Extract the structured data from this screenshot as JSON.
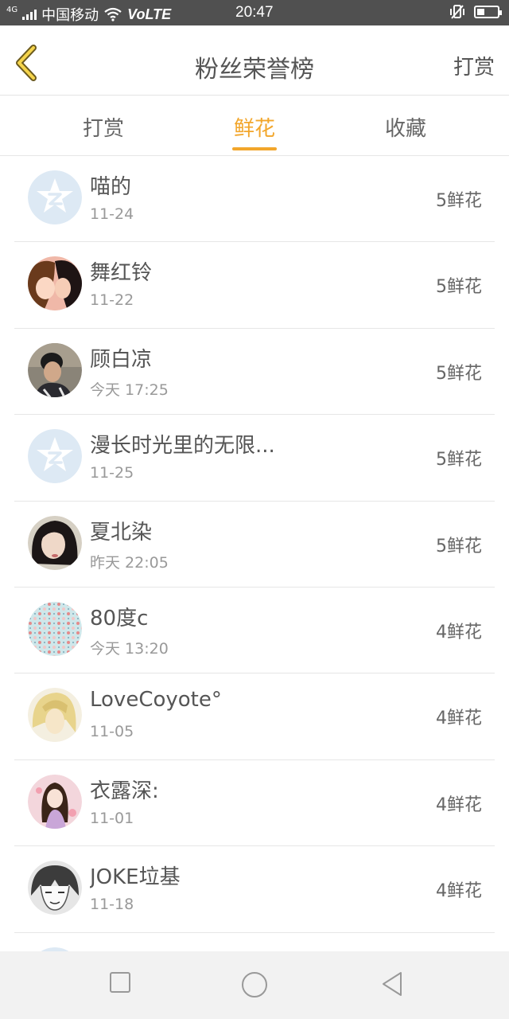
{
  "status_bar": {
    "network": "4G",
    "carrier": "中国移动",
    "volte": "VoLTE",
    "time": "20:47"
  },
  "header": {
    "title": "粉丝荣誉榜",
    "action": "打赏"
  },
  "tabs": [
    {
      "label": "打赏",
      "active": false
    },
    {
      "label": "鲜花",
      "active": true
    },
    {
      "label": "收藏",
      "active": false
    }
  ],
  "accent_color": "#f2a62b",
  "rows": [
    {
      "name": "喵的",
      "date": "11-24",
      "amount": "5鲜花",
      "avatar": "default-qq-avatar"
    },
    {
      "name": "舞红铃",
      "date": "11-22",
      "amount": "5鲜花",
      "avatar": "anime-couple-avatar"
    },
    {
      "name": "顾白凉",
      "date": "今天 17:25",
      "amount": "5鲜花",
      "avatar": "photo-man-avatar"
    },
    {
      "name": "漫长时光里的无限...",
      "date": "11-25",
      "amount": "5鲜花",
      "avatar": "default-qq-avatar"
    },
    {
      "name": "夏北染",
      "date": "昨天 22:05",
      "amount": "5鲜花",
      "avatar": "photo-girl-avatar"
    },
    {
      "name": "80度c",
      "date": "今天 13:20",
      "amount": "4鲜花",
      "avatar": "floral-pattern-avatar"
    },
    {
      "name": "LoveCoyote°",
      "date": "11-05",
      "amount": "4鲜花",
      "avatar": "anime-blonde-avatar"
    },
    {
      "name": "衣露深:",
      "date": "11-01",
      "amount": "4鲜花",
      "avatar": "illustrated-girl-avatar"
    },
    {
      "name": "JOKE垃基",
      "date": "11-18",
      "amount": "4鲜花",
      "avatar": "anime-sketch-avatar"
    }
  ],
  "nav": [
    "square-icon",
    "circle-icon",
    "back-triangle-icon"
  ]
}
